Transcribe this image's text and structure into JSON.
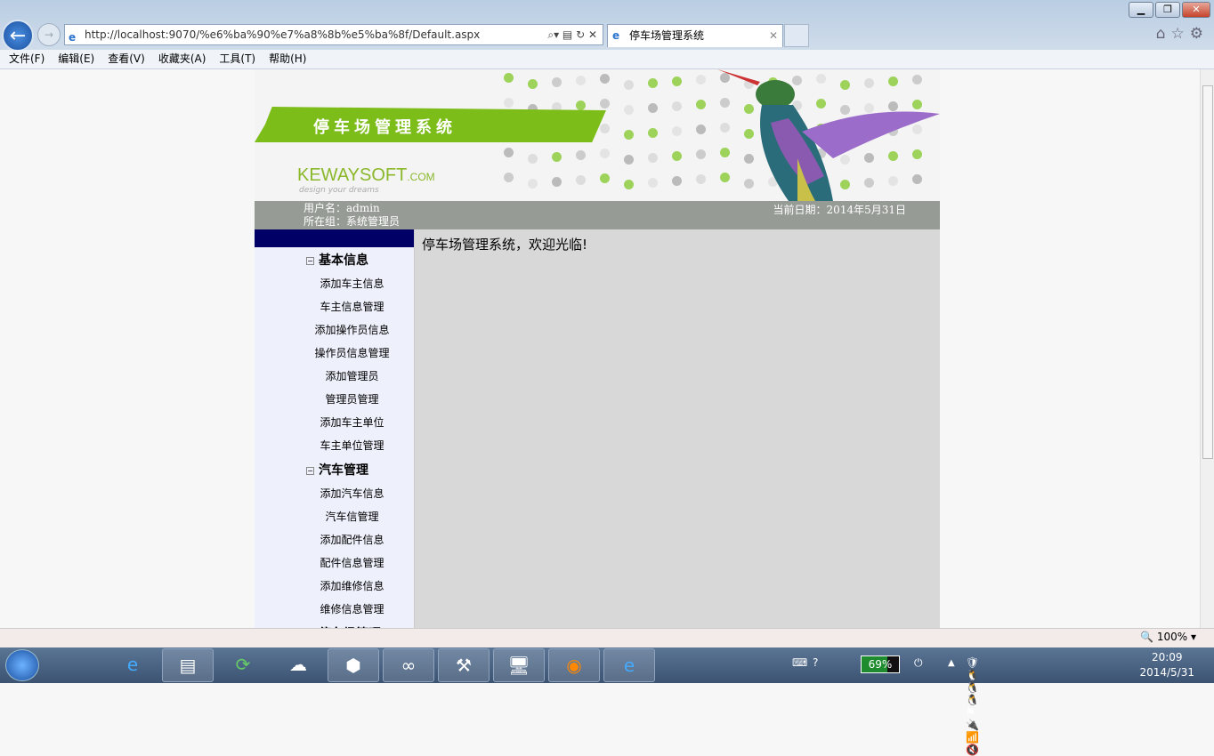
{
  "browser": {
    "url": "http://localhost:9070/%e6%ba%90%e7%a8%8b%e5%ba%8f/Default.aspx",
    "tab_title": "停车场管理系统",
    "menu": [
      "文件(F)",
      "编辑(E)",
      "查看(V)",
      "收藏夹(A)",
      "工具(T)",
      "帮助(H)"
    ],
    "zoom": "100%"
  },
  "banner": {
    "title": "停车场管理系统",
    "logo": "KEWAYSOFT",
    "logo_suffix": ".COM",
    "slogan": "design your dreams"
  },
  "userbar": {
    "username": "用户名：admin",
    "group": "所在组：系统管理员",
    "date": "当前日期：2014年5月31日"
  },
  "sidebar": {
    "groups": [
      {
        "label": "基本信息",
        "items": [
          "添加车主信息",
          "车主信息管理",
          "添加操作员信息",
          "操作员信息管理",
          "添加管理员",
          "管理员管理",
          "添加车主单位",
          "车主单位管理"
        ]
      },
      {
        "label": "汽车管理",
        "items": [
          "添加汽车信息",
          "汽车信管理",
          "添加配件信息",
          "配件信息管理",
          "添加维修信息",
          "维修信息管理"
        ]
      },
      {
        "label": "停车场管理",
        "items": []
      }
    ]
  },
  "main": {
    "welcome": "停车场管理系统，欢迎光临!"
  },
  "taskbar": {
    "battery": "69%",
    "battery_level": 0.69,
    "time": "20:09",
    "date": "2014/5/31"
  }
}
